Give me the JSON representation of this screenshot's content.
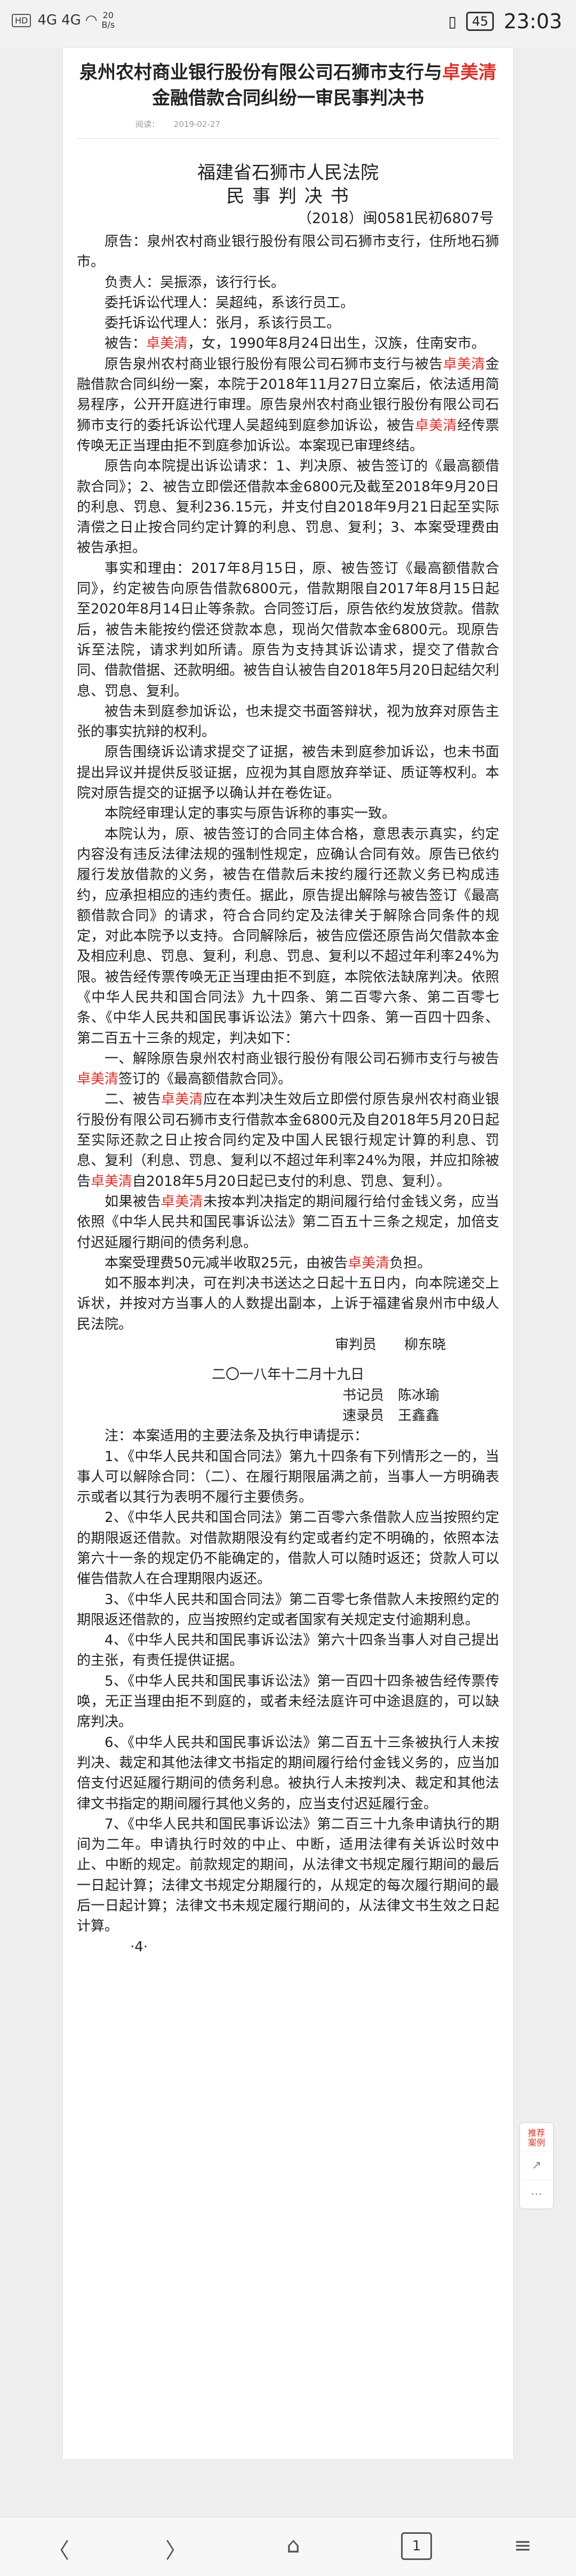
{
  "status_bar": {
    "left_chip": "HD",
    "net_1": "4G",
    "net_2": "4G",
    "speed": "20\nB/s",
    "battery": "45",
    "time": "23:03"
  },
  "article": {
    "title_before": "泉州农村商业银行股份有限公司石狮市支行与",
    "title_party": "卓美清",
    "title_after": "金融借款合同纠纷一审民事判决书",
    "meta_views": "阅读：",
    "meta_date": "2019-02-27"
  },
  "doc": {
    "court": "福建省石狮市人民法院",
    "doctype": "民 事 判 决 书",
    "caseno": "（2018）闽0581民初6807号",
    "paragraphs": [
      "原告：泉州农村商业银行股份有限公司石狮市支行，住所地石狮市。",
      "负责人：吴振添，该行行长。",
      "委托诉讼代理人：吴超纯，系该行员工。",
      "委托诉讼代理人：张月，系该行员工。",
      "被告：卓美清，女，1990年8月24日出生，汉族，住南安市。",
      "原告泉州农村商业银行股份有限公司石狮市支行与被告卓美清金融借款合同纠纷一案，本院于2018年11月27日立案后，依法适用简易程序，公开开庭进行审理。原告泉州农村商业银行股份有限公司石狮市支行的委托诉讼代理人吴超纯到庭参加诉讼，被告卓美清经传票传唤无正当理由拒不到庭参加诉讼。本案现已审理终结。",
      "原告向本院提出诉讼请求：1、判决原、被告签订的《最高额借款合同》；2、被告立即偿还借款本金6800元及截至2018年9月20日的利息、罚息、复利236.15元，并支付自2018年9月21日起至实际清偿之日止按合同约定计算的利息、罚息、复利；3、本案受理费由被告承担。",
      "事实和理由：2017年8月15日，原、被告签订《最高额借款合同》，约定被告向原告借款6800元，借款期限自2017年8月15日起至2020年8月14日止等条款。合同签订后，原告依约发放贷款。借款后，被告未能按约偿还贷款本息，现尚欠借款本金6800元。现原告诉至法院，请求判如所请。原告为支持其诉讼请求，提交了借款合同、借款借据、还款明细。被告自认被告自2018年5月20日起结欠利息、罚息、复利。",
      "被告未到庭参加诉讼，也未提交书面答辩状，视为放弃对原告主张的事实抗辩的权利。",
      "原告围绕诉讼请求提交了证据，被告未到庭参加诉讼，也未书面提出异议并提供反驳证据，应视为其自愿放弃举证、质证等权利。本院对原告提交的证据予以确认并在卷佐证。",
      "本院经审理认定的事实与原告诉称的事实一致。",
      "本院认为，原、被告签订的合同主体合格，意思表示真实，约定内容没有违反法律法规的强制性规定，应确认合同有效。原告已依约履行发放借款的义务，被告在借款后未按约履行还款义务已构成违约，应承担相应的违约责任。据此，原告提出解除与被告签订《最高额借款合同》的请求，符合合同约定及法律关于解除合同条件的规定，对此本院予以支持。合同解除后，被告应偿还原告尚欠借款本金及相应利息、罚息、复利，利息、罚息、复利以不超过年利率24%为限。被告经传票传唤无正当理由拒不到庭，本院依法缺席判决。依照《中华人民共和国合同法》九十四条、第二百零六条、第二百零七条、《中华人民共和国民事诉讼法》第六十四条、第一百四十四条、第二百五十三条的规定，判决如下：",
      "一、解除原告泉州农村商业银行股份有限公司石狮市支行与被告卓美清签订的《最高额借款合同》。",
      "二、被告卓美清应在本判决生效后立即偿付原告泉州农村商业银行股份有限公司石狮市支行借款本金6800元及自2018年5月20日起至实际还款之日止按合同约定及中国人民银行规定计算的利息、罚息、复利（利息、罚息、复利以不超过年利率24%为限，并应扣除被告卓美清自2018年5月20日起已支付的利息、罚息、复利）。",
      "如果被告卓美清未按本判决指定的期间履行给付金钱义务，应当依照《中华人民共和国民事诉讼法》第二百五十三条之规定，加倍支付迟延履行期间的债务利息。",
      "本案受理费50元减半收取25元，由被告卓美清负担。",
      "如不服本判决，可在判决书送达之日起十五日内，向本院递交上诉状，并按对方当事人的人数提出副本，上诉于福建省泉州市中级人民法院。",
      "二〇一八年十二月十九日"
    ],
    "judge": "审判员　　柳东晓",
    "clerk": "书记员　陈冰瑜",
    "shorthand": "速录员　王鑫鑫",
    "notes": [
      "注：本案适用的主要法条及执行申请提示：",
      "1、《中华人民共和国合同法》第九十四条有下列情形之一的，当事人可以解除合同：（二）、在履行期限届满之前，当事人一方明确表示或者以其行为表明不履行主要债务。",
      "2、《中华人民共和国合同法》第二百零六条借款人应当按照约定的期限返还借款。对借款期限没有约定或者约定不明确的，依照本法第六十一条的规定仍不能确定的，借款人可以随时返还；贷款人可以催告借款人在合理期限内返还。",
      "3、《中华人民共和国合同法》第二百零七条借款人未按照约定的期限返还借款的，应当按照约定或者国家有关规定支付逾期利息。",
      "4、《中华人民共和国民事诉讼法》第六十四条当事人对自己提出的主张，有责任提供证据。",
      "5、《中华人民共和国民事诉讼法》第一百四十四条被告经传票传唤，无正当理由拒不到庭的，或者未经法庭许可中途退庭的，可以缺席判决。",
      "6、《中华人民共和国民事诉讼法》第二百五十三条被执行人未按判决、裁定和其他法律文书指定的期间履行给付金钱义务的，应当加倍支付迟延履行期间的债务利息。被执行人未按判决、裁定和其他法律文书指定的期间履行其他义务的，应当支付迟延履行金。",
      "7、《中华人民共和国民事诉讼法》第二百三十九条申请执行的期间为二年。申请执行时效的中止、中断，适用法律有关诉讼时效中止、中断的规定。前款规定的期间，从法律文书规定履行期间的最后一日起计算；法律文书规定分期履行的，从规定的每次履行期间的最后一日起计算；法律文书未规定履行期间的，从法律文书生效之日起计算。",
      "·4·"
    ]
  },
  "floating": {
    "rec_label": "推荐\n案例",
    "share_icon": "share-icon",
    "more_icon": "more-icon"
  },
  "nav": {
    "back": "〈",
    "forward": "〉",
    "home": "⌂",
    "page": "1",
    "menu": "≡"
  }
}
